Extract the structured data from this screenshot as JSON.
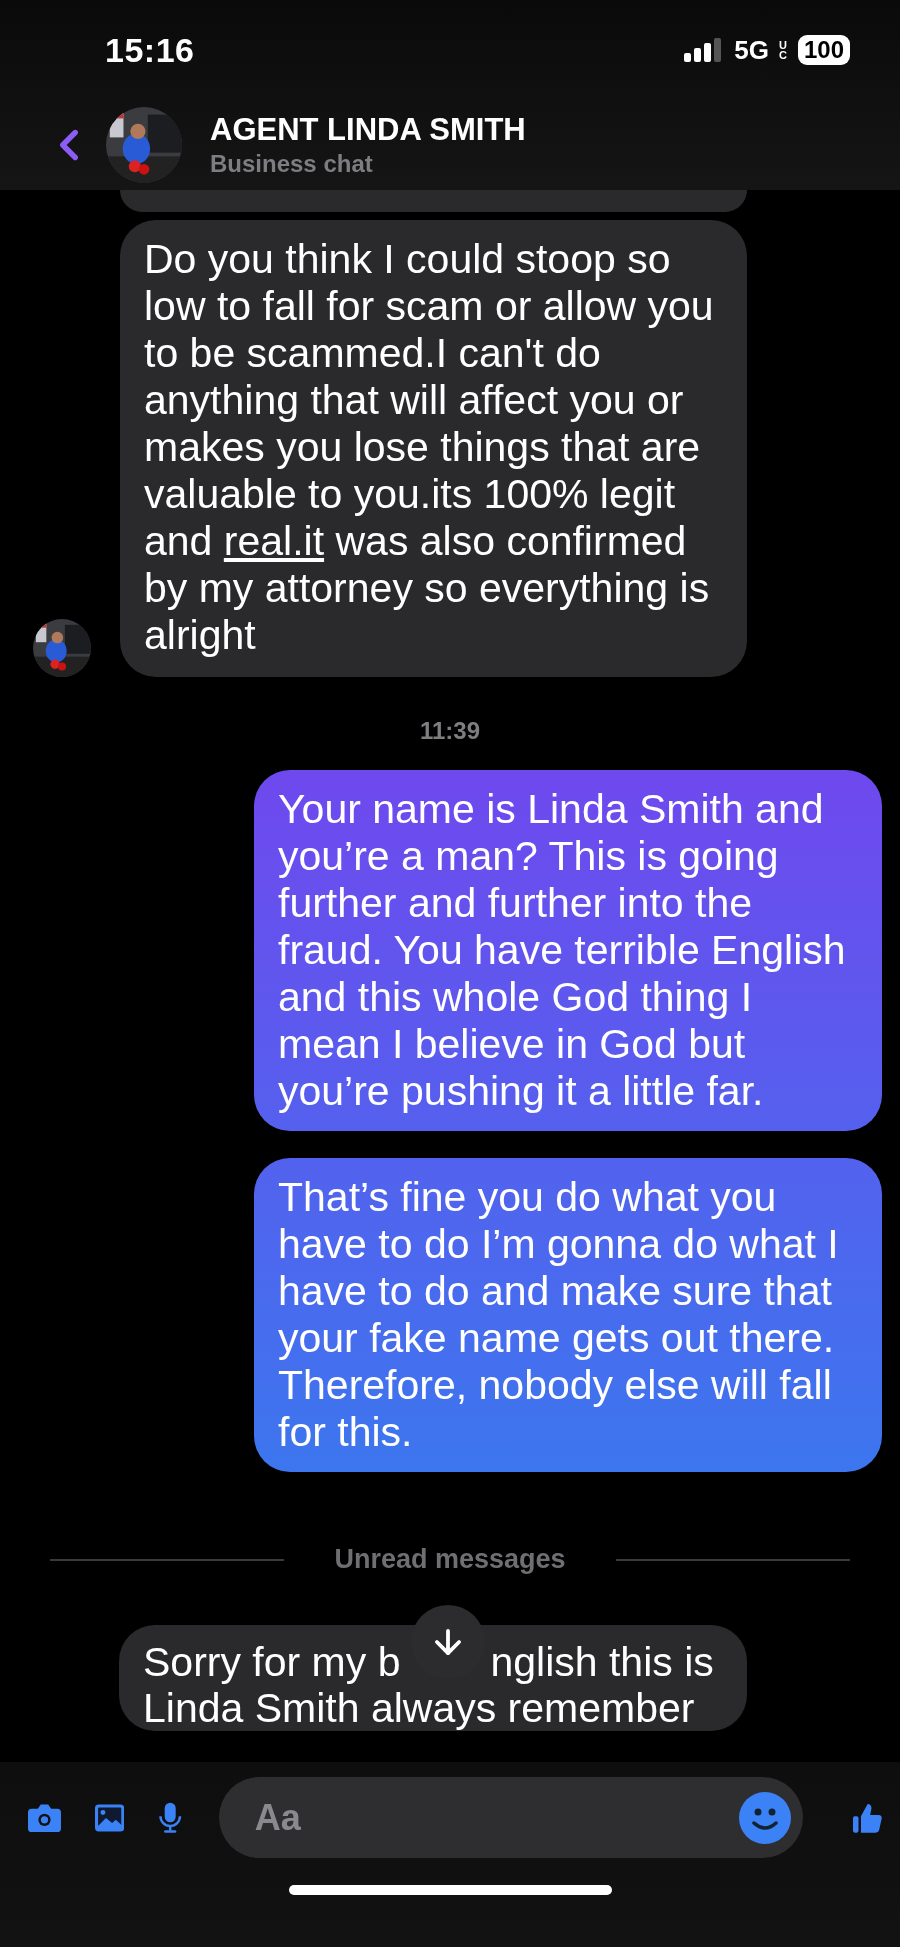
{
  "status_bar": {
    "time": "15:16",
    "network": "5G",
    "network_badge": "UC",
    "battery": "100"
  },
  "header": {
    "title": "AGENT LINDA SMITH",
    "subtitle": "Business chat"
  },
  "feed": [
    {
      "kind": "edge"
    },
    {
      "kind": "incoming",
      "avatar": true,
      "parts": [
        {
          "kind": "plain",
          "text": "Do you think I could stoop so low to fall for scam or allow you to be scammed.I can't do anything that will affect you or makes you lose things that are valuable to you.its 100% legit and "
        },
        {
          "kind": "link",
          "text": "real.it"
        },
        {
          "kind": "plain",
          "text": " was also confirmed by my attorney so everything is alright"
        }
      ]
    },
    {
      "kind": "time",
      "text": "11:39"
    },
    {
      "kind": "outgoing",
      "parts": [
        {
          "kind": "plain",
          "text": "Your name is Linda Smith and you’re a man? This is going further and further into the fraud. You have terrible English and this whole God thing I mean I believe in God but you’re pushing it a little far."
        }
      ]
    },
    {
      "kind": "outgoing",
      "parts": [
        {
          "kind": "plain",
          "text": "That’s fine you do what you have to do I’m gonna do what I have to do and make sure that your fake name gets out there. Therefore, nobody else will fall for this."
        }
      ]
    },
    {
      "kind": "divider",
      "text": "Unread messages"
    },
    {
      "kind": "covered",
      "first_left": "Sorry for my b",
      "first_right": "nglish this is",
      "second": "Linda Smith always remember"
    }
  ],
  "composer": {
    "placeholder": "Aa"
  }
}
